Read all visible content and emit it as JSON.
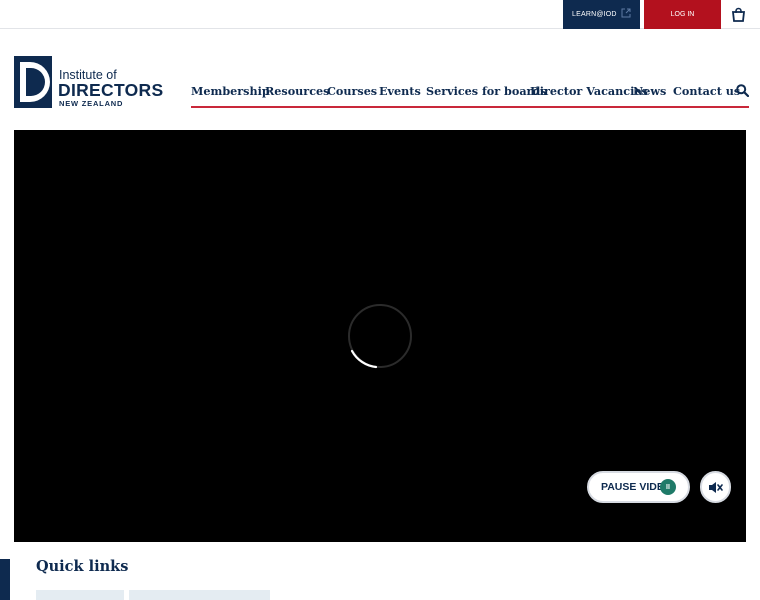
{
  "topbar": {
    "learn_label": "LEARN@IOD",
    "login_label": "LOG IN"
  },
  "logo": {
    "line1": "Institute of",
    "line2": "DIRECTORS",
    "line3": "NEW ZEALAND"
  },
  "nav": {
    "items": [
      {
        "label": "Membership"
      },
      {
        "label": "Resources"
      },
      {
        "label": "Courses"
      },
      {
        "label": "Events"
      },
      {
        "label": "Services for boards"
      },
      {
        "label": "Director Vacancies"
      },
      {
        "label": "News"
      },
      {
        "label": "Contact us"
      }
    ]
  },
  "video": {
    "pause_label": "PAUSE VIDEO",
    "pause_glyph": "II"
  },
  "quick_links": {
    "title": "Quick links"
  },
  "colors": {
    "navy": "#0e2a4f",
    "red": "#b3111e",
    "teal": "#1f7a68",
    "nav_underline": "#c9283a"
  },
  "icons": [
    "external-link-icon",
    "shopping-bag-icon",
    "search-icon",
    "loading-spinner-icon",
    "pause-icon",
    "mute-icon"
  ]
}
